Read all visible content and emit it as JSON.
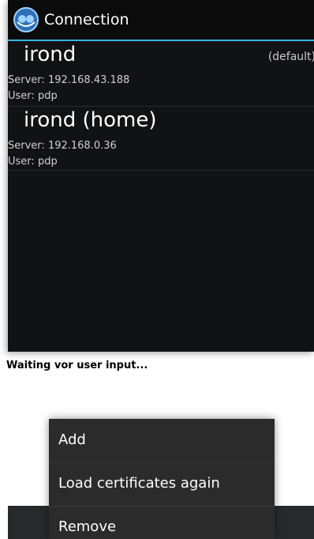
{
  "app": {
    "title": "Connection",
    "icon": "user-headset-icon",
    "accent_color": "#33b5e5"
  },
  "connections": [
    {
      "name": "irond",
      "badge": "(default)",
      "server_label": "Server:",
      "server_value": "192.168.43.188",
      "user_label": "User:",
      "user_value": "pdp"
    },
    {
      "name": "irond (home)",
      "server_label": "Server:",
      "server_value": "192.168.0.36",
      "user_label": "User:",
      "user_value": "pdp"
    }
  ],
  "status_text": "Waiting vor user input...",
  "context_menu": {
    "items": [
      {
        "label": "Add"
      },
      {
        "label": "Load certificates again"
      },
      {
        "label": "Remove"
      }
    ]
  }
}
